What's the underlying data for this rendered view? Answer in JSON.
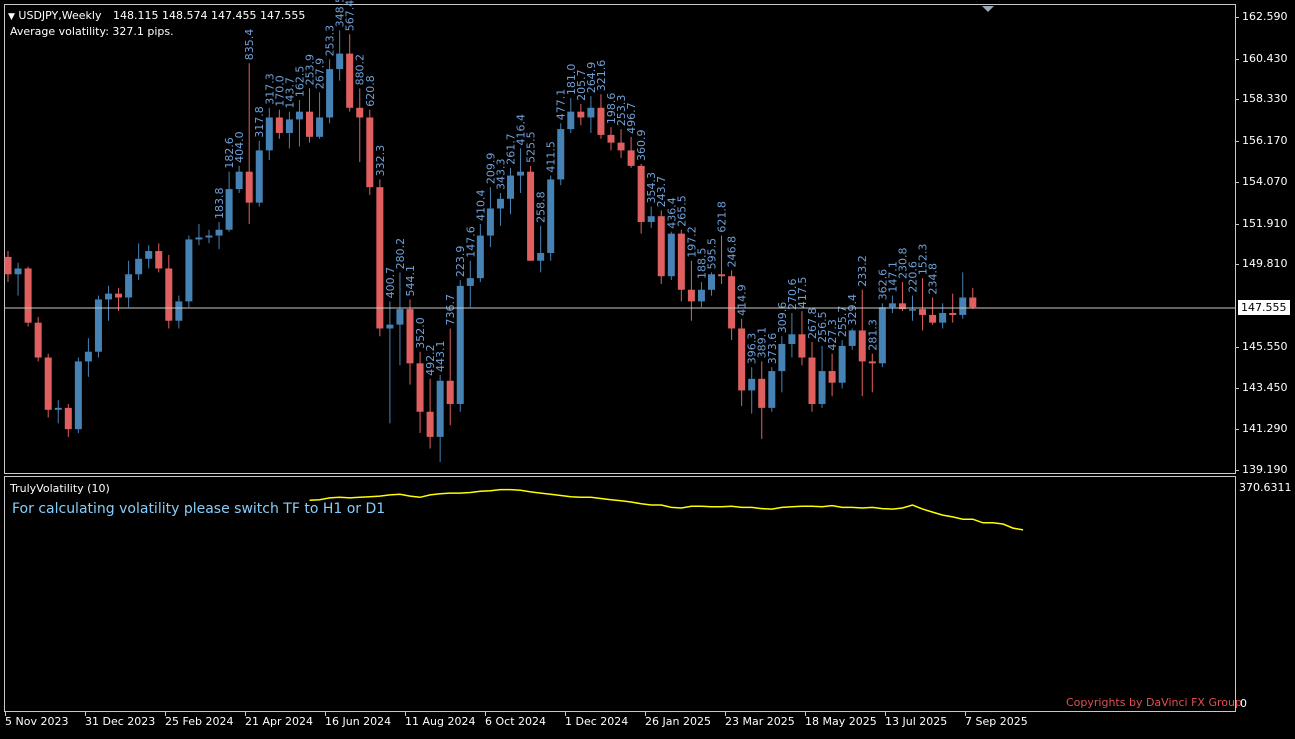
{
  "header": {
    "symbol_timeframe": "USDJPY,Weekly",
    "ohlc": "148.115 148.574 147.455 147.555",
    "avg_volatility": "Average volatility: 327.1 pips."
  },
  "price_axis": {
    "labels": [
      "162.590",
      "160.430",
      "158.330",
      "156.170",
      "154.070",
      "151.910",
      "149.810",
      "147.555",
      "145.550",
      "143.450",
      "141.290",
      "139.190"
    ],
    "current_price": "147.555"
  },
  "indicator": {
    "title": "TrulyVolatility (10)",
    "message": "For calculating volatility please switch TF to H1 or D1",
    "copyright": "Copyrights by DaVinci FX Group",
    "axis_max": "370.6311",
    "axis_min": "0",
    "line_color": "#ffff00",
    "values": [
      0,
      0,
      0,
      0,
      0,
      0,
      0,
      0,
      0,
      0,
      0,
      0,
      0,
      0,
      0,
      0,
      0,
      0,
      0,
      0,
      0,
      0,
      0,
      0,
      0,
      0,
      0,
      0,
      0,
      0,
      350,
      351,
      354,
      355,
      354,
      355,
      356,
      357,
      359,
      360,
      357,
      355,
      359,
      361,
      362,
      362,
      363,
      365,
      366,
      368,
      368,
      367,
      364,
      362,
      360,
      358,
      356,
      355,
      355,
      353,
      351,
      349,
      347,
      344,
      342,
      342,
      338,
      337,
      340,
      340,
      339,
      339,
      340,
      338,
      338,
      336,
      335,
      338,
      339,
      340,
      340,
      339,
      341,
      338,
      338,
      337,
      338,
      336,
      335,
      337,
      342,
      335,
      330,
      325,
      322,
      318,
      318,
      312,
      312,
      310,
      303,
      300
    ]
  },
  "date_axis": [
    "5 Nov 2023",
    "31 Dec 2023",
    "25 Feb 2024",
    "21 Apr 2024",
    "16 Jun 2024",
    "11 Aug 2024",
    "6 Oct 2024",
    "1 Dec 2024",
    "26 Jan 2025",
    "23 Mar 2025",
    "18 May 2025",
    "13 Jul 2025",
    "7 Sep 2025"
  ],
  "colors": {
    "bull": "#4682b4",
    "bear": "#e06060",
    "label": "#6fa0d8",
    "copyright": "#e05050",
    "message": "#87cefa"
  },
  "chart_data": {
    "type": "candlestick",
    "symbol": "USDJPY",
    "timeframe": "Weekly",
    "y_range": [
      139.19,
      162.59
    ],
    "candles": [
      [
        150.2,
        150.5,
        148.9,
        149.3,
        null
      ],
      [
        149.3,
        149.9,
        148.2,
        149.6,
        null
      ],
      [
        149.6,
        149.7,
        146.6,
        146.8,
        null
      ],
      [
        146.8,
        147.1,
        144.8,
        145.0,
        null
      ],
      [
        145.0,
        145.2,
        141.9,
        142.3,
        null
      ],
      [
        142.3,
        142.8,
        141.6,
        142.4,
        null
      ],
      [
        142.4,
        142.6,
        140.9,
        141.3,
        null
      ],
      [
        141.3,
        145.0,
        141.1,
        144.8,
        null
      ],
      [
        144.8,
        146.0,
        144.0,
        145.3,
        null
      ],
      [
        145.3,
        148.2,
        145.0,
        148.0,
        null
      ],
      [
        148.0,
        148.7,
        146.9,
        148.3,
        null
      ],
      [
        148.3,
        148.6,
        147.4,
        148.1,
        null
      ],
      [
        148.1,
        150.0,
        147.6,
        149.3,
        null
      ],
      [
        149.3,
        150.9,
        149.0,
        150.1,
        null
      ],
      [
        150.1,
        150.8,
        149.6,
        150.5,
        null
      ],
      [
        150.5,
        150.9,
        149.4,
        149.6,
        null
      ],
      [
        149.6,
        150.3,
        146.5,
        146.9,
        null
      ],
      [
        146.9,
        148.2,
        146.5,
        147.9,
        null
      ],
      [
        147.9,
        151.3,
        147.6,
        151.1,
        null
      ],
      [
        151.1,
        151.9,
        150.8,
        151.2,
        null
      ],
      [
        151.2,
        151.6,
        150.9,
        151.3,
        null
      ],
      [
        151.3,
        152.0,
        150.6,
        151.6,
        183.8
      ],
      [
        151.6,
        154.6,
        151.5,
        153.7,
        182.6
      ],
      [
        153.7,
        154.9,
        153.5,
        154.6,
        404.0
      ],
      [
        154.6,
        160.2,
        151.9,
        153.0,
        835.4
      ],
      [
        153.0,
        156.2,
        152.8,
        155.7,
        317.8
      ],
      [
        155.7,
        157.9,
        155.2,
        157.4,
        317.3
      ],
      [
        157.4,
        157.8,
        156.3,
        156.6,
        170.0
      ],
      [
        156.6,
        157.7,
        155.8,
        157.3,
        143.7
      ],
      [
        157.3,
        158.3,
        155.9,
        157.7,
        162.5
      ],
      [
        157.7,
        158.9,
        156.1,
        156.4,
        253.9
      ],
      [
        156.4,
        158.7,
        156.3,
        157.4,
        267.9
      ],
      [
        157.4,
        160.4,
        157.1,
        159.9,
        253.3
      ],
      [
        159.9,
        161.9,
        159.3,
        160.7,
        348.5
      ],
      [
        160.7,
        161.7,
        157.7,
        157.9,
        567.4
      ],
      [
        157.9,
        158.9,
        155.1,
        157.4,
        880.2
      ],
      [
        157.4,
        157.8,
        153.4,
        153.8,
        620.8
      ],
      [
        153.8,
        154.2,
        146.1,
        146.5,
        332.3
      ],
      [
        146.5,
        147.9,
        141.6,
        146.7,
        400.7
      ],
      [
        146.7,
        149.4,
        144.6,
        147.5,
        280.2
      ],
      [
        147.5,
        148.0,
        143.6,
        144.7,
        544.1
      ],
      [
        144.7,
        145.3,
        141.1,
        142.2,
        352.0
      ],
      [
        142.2,
        143.9,
        140.3,
        140.9,
        492.2
      ],
      [
        140.9,
        144.1,
        139.6,
        143.8,
        443.1
      ],
      [
        143.8,
        146.5,
        141.5,
        142.6,
        736.7
      ],
      [
        142.6,
        149.0,
        142.2,
        148.7,
        223.9
      ],
      [
        148.7,
        150.0,
        147.6,
        149.1,
        147.6
      ],
      [
        149.1,
        151.9,
        148.9,
        151.3,
        410.4
      ],
      [
        151.3,
        153.8,
        150.7,
        152.7,
        209.9
      ],
      [
        152.7,
        153.5,
        151.8,
        153.2,
        343.3
      ],
      [
        153.2,
        154.8,
        152.4,
        154.4,
        261.7
      ],
      [
        154.4,
        155.8,
        153.5,
        154.6,
        416.4
      ],
      [
        154.6,
        154.9,
        150.0,
        150.0,
        525.5
      ],
      [
        150.0,
        151.8,
        149.4,
        150.4,
        258.8
      ],
      [
        150.4,
        154.4,
        150.0,
        154.2,
        411.5
      ],
      [
        154.2,
        157.1,
        153.9,
        156.8,
        477.1
      ],
      [
        156.8,
        158.4,
        156.6,
        157.7,
        181.0
      ],
      [
        157.7,
        158.1,
        157.0,
        157.4,
        205.7
      ],
      [
        157.4,
        158.5,
        156.6,
        157.9,
        264.9
      ],
      [
        157.9,
        158.6,
        156.3,
        156.5,
        321.6
      ],
      [
        156.5,
        156.9,
        155.7,
        156.1,
        198.6
      ],
      [
        156.1,
        156.8,
        155.3,
        155.7,
        253.3
      ],
      [
        155.7,
        156.4,
        154.8,
        154.9,
        496.7
      ],
      [
        154.9,
        155.0,
        151.4,
        152.0,
        360.9
      ],
      [
        152.0,
        152.8,
        151.7,
        152.3,
        354.3
      ],
      [
        152.3,
        152.6,
        148.8,
        149.2,
        243.7
      ],
      [
        149.2,
        151.5,
        149.0,
        151.4,
        436.4
      ],
      [
        151.4,
        151.6,
        147.9,
        148.5,
        265.5
      ],
      [
        148.5,
        150.0,
        146.9,
        147.9,
        197.2
      ],
      [
        147.9,
        148.9,
        147.6,
        148.5,
        188.5
      ],
      [
        148.5,
        149.4,
        148.2,
        149.3,
        595.5
      ],
      [
        149.3,
        151.3,
        148.8,
        149.2,
        621.8
      ],
      [
        149.2,
        149.5,
        145.9,
        146.5,
        246.8
      ],
      [
        146.5,
        147.0,
        142.5,
        143.3,
        414.9
      ],
      [
        143.3,
        144.5,
        142.1,
        143.9,
        396.3
      ],
      [
        143.9,
        144.8,
        140.8,
        142.4,
        389.1
      ],
      [
        142.4,
        144.5,
        142.2,
        144.3,
        373.6
      ],
      [
        144.3,
        146.1,
        143.2,
        145.7,
        309.6
      ],
      [
        145.7,
        147.3,
        145.0,
        146.2,
        270.6
      ],
      [
        146.2,
        147.4,
        144.6,
        145.0,
        417.5
      ],
      [
        145.0,
        145.8,
        142.2,
        142.6,
        267.8
      ],
      [
        142.6,
        145.6,
        142.4,
        144.3,
        256.5
      ],
      [
        144.3,
        145.2,
        143.0,
        143.7,
        427.3
      ],
      [
        143.7,
        145.9,
        143.4,
        145.6,
        255.7
      ],
      [
        145.6,
        146.5,
        145.4,
        146.4,
        329.4
      ],
      [
        146.4,
        148.5,
        143.0,
        144.8,
        233.2
      ],
      [
        144.8,
        145.2,
        143.2,
        144.7,
        281.3
      ],
      [
        144.7,
        147.8,
        144.5,
        147.6,
        362.6
      ],
      [
        147.6,
        148.2,
        147.3,
        147.8,
        147.1
      ],
      [
        147.8,
        148.9,
        147.4,
        147.5,
        230.8
      ],
      [
        147.5,
        148.2,
        146.9,
        147.5,
        220.6
      ],
      [
        147.5,
        149.1,
        146.4,
        147.2,
        152.3
      ],
      [
        147.2,
        148.1,
        146.7,
        146.8,
        234.8
      ],
      [
        146.8,
        147.8,
        146.5,
        147.3,
        null
      ],
      [
        147.3,
        148.3,
        146.8,
        147.2,
        null
      ],
      [
        147.2,
        149.4,
        147.0,
        148.1,
        null
      ],
      [
        148.1,
        148.6,
        147.5,
        147.6,
        null
      ]
    ]
  }
}
